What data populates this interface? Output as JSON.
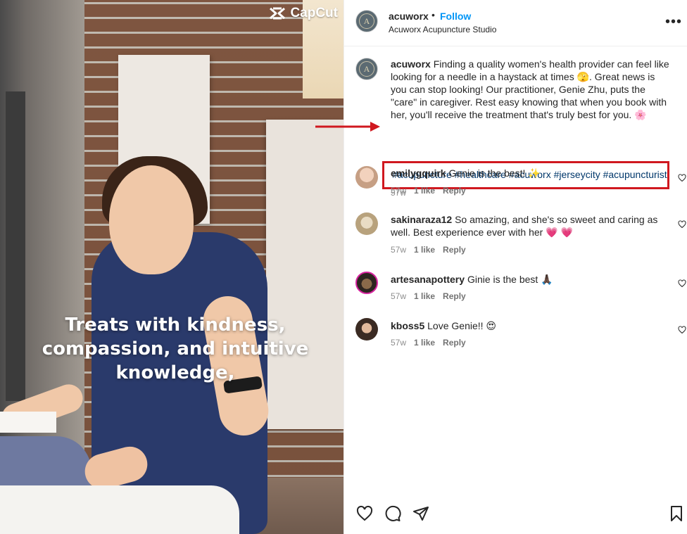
{
  "app": "Instagram",
  "colors": {
    "accent": "#0095f6",
    "highlight_box": "#d0181f",
    "hashtag": "#00376b",
    "muted": "#8e8e8e"
  },
  "media": {
    "watermark": "CapCut",
    "caption_lines": [
      "Treats with kindness,",
      "compassion, and intuitive",
      "knowledge,"
    ]
  },
  "header": {
    "avatar_letter": "A",
    "username": "acuworx",
    "separator": "•",
    "follow_label": "Follow",
    "subtitle": "Acuworx Acupuncture Studio",
    "more_icon": "more-horizontal-icon"
  },
  "post_caption": {
    "username": "acuworx",
    "text": "Finding a quality women's health provider can feel like looking for a needle in a haystack at times 🫣. Great news is you can stop looking! Our practitioner, Genie Zhu, puts the \"care\" in caregiver. Rest easy knowing that when you book with her, you'll receive the treatment that's truly best for you. 🌸",
    "hashtags": "#acupuncture #healthcare #acuworx #jerseycity #acupuncturist",
    "time": "57w"
  },
  "comments": [
    {
      "username": "emilygquirk",
      "text": "Genie is the best! ✨",
      "time": "57w",
      "likes": "1 like",
      "reply": "Reply"
    },
    {
      "username": "sakinaraza12",
      "text": "So amazing, and she's so sweet and caring as well. Best experience ever with her 💗 💗",
      "time": "57w",
      "likes": "1 like",
      "reply": "Reply"
    },
    {
      "username": "artesanapottery",
      "text": "Ginie is the best 🙏🏿",
      "time": "57w",
      "likes": "1 like",
      "reply": "Reply"
    },
    {
      "username": "kboss5",
      "text": "Love Genie!! 😍",
      "time": "57w",
      "likes": "1 like",
      "reply": "Reply"
    }
  ],
  "actions": [
    "heart-icon",
    "comment-icon",
    "share-icon",
    "bookmark-icon"
  ]
}
